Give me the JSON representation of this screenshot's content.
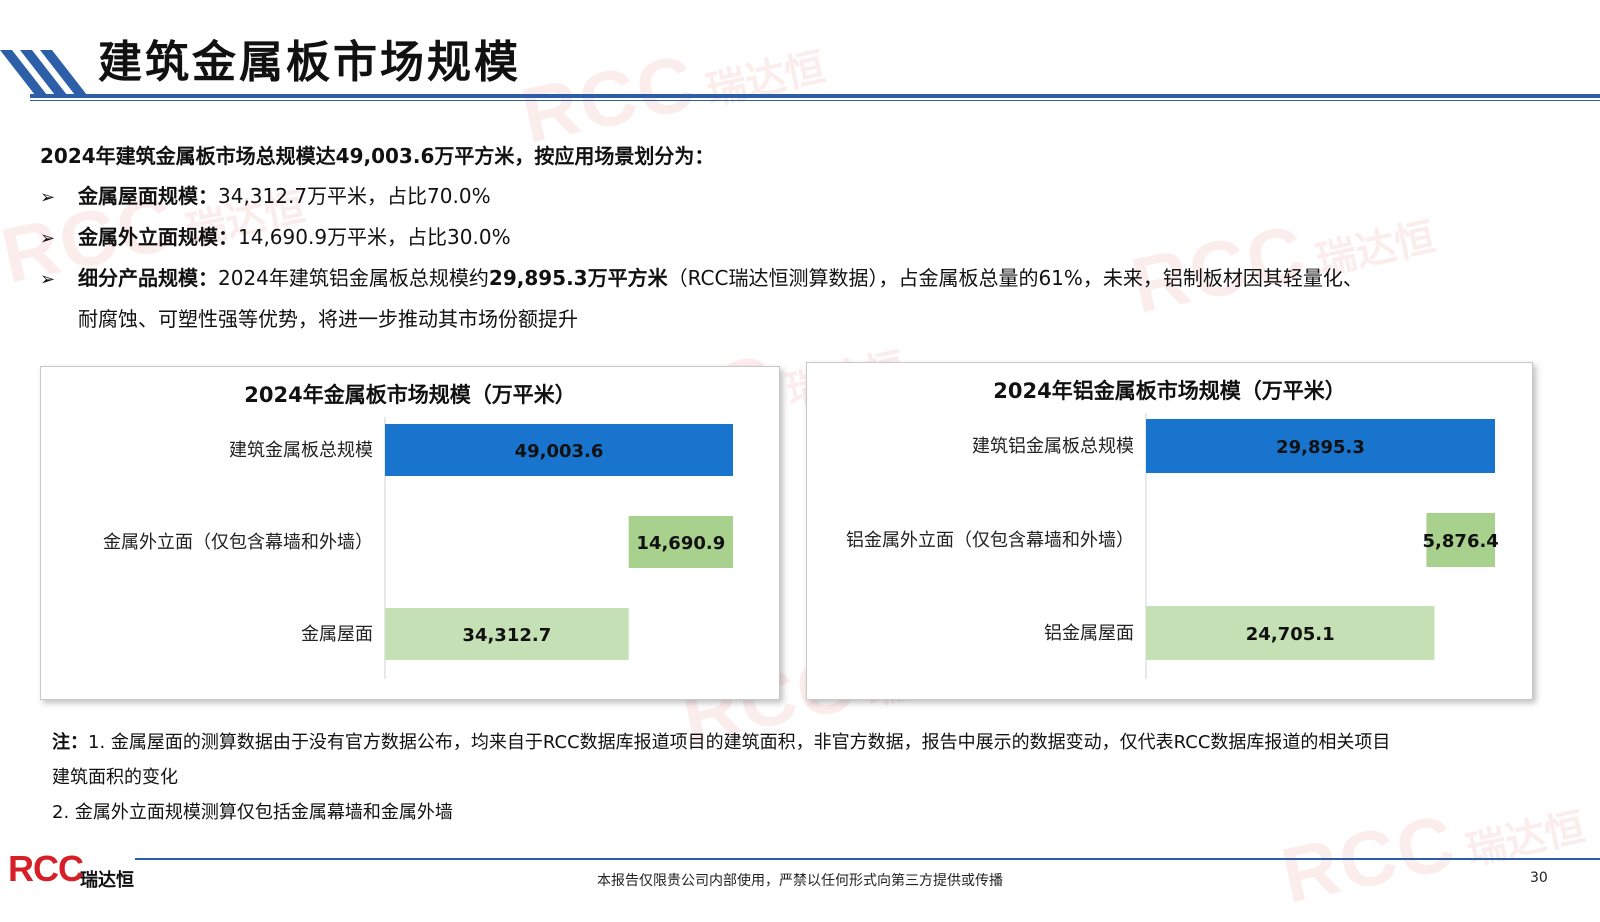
{
  "page": {
    "title": "建筑金属板市场规模",
    "number": "30",
    "footer": "本报告仅限贵公司内部使用，严禁以任何形式向第三方提供或传播",
    "logo_text": "RCC",
    "logo_cn": "瑞达恒",
    "watermark_text": "RCC",
    "watermark_cn": "瑞达恒"
  },
  "summary": {
    "intro": "2024年建筑金属板市场总规模达49,003.6万平方米，按应用场景划分为：",
    "bullets": [
      {
        "marker": "➢",
        "label": "金属屋面规模：",
        "text": "34,312.7万平米，占比70.0%"
      },
      {
        "marker": "➢",
        "label": "金属外立面规模：",
        "text": "14,690.9万平米，占比30.0%"
      },
      {
        "marker": "➢",
        "label": "细分产品规模：",
        "text_a": "2024年建筑铝金属板总规模约",
        "text_b": "29,895.3万平方米",
        "text_c": "（RCC瑞达恒测算数据），占金属板总量的61%，未来，铝制板材因其轻量化、",
        "text_d": "耐腐蚀、可塑性强等优势，将进一步推动其市场份额提升"
      }
    ]
  },
  "chart_data": [
    {
      "type": "bar",
      "orientation": "horizontal",
      "subtype": "waterfall",
      "title": "2024年金属板市场规模（万平米）",
      "categories": [
        "建筑金属板总规模",
        "金属外立面（仅包含幕墙和外墙）",
        "金属屋面"
      ],
      "values": [
        49003.6,
        14690.9,
        34312.7
      ],
      "value_labels": [
        "49,003.6",
        "14,690.9",
        "34,312.7"
      ],
      "offsets": [
        0,
        34312.7,
        0
      ],
      "colors": [
        "#1874cd",
        "#a9d18e",
        "#c5e0b4"
      ],
      "xlim": [
        0,
        49003.6
      ]
    },
    {
      "type": "bar",
      "orientation": "horizontal",
      "subtype": "waterfall",
      "title": "2024年铝金属板市场规模（万平米）",
      "categories": [
        "建筑铝金属板总规模",
        "铝金属外立面（仅包含幕墙和外墙）",
        "铝金属屋面"
      ],
      "values": [
        29895.3,
        5876.4,
        24705.1
      ],
      "value_labels": [
        "29,895.3",
        "5,876.4",
        "24,705.1"
      ],
      "offsets": [
        0,
        24018.9,
        0
      ],
      "colors": [
        "#1874cd",
        "#a9d18e",
        "#c5e0b4"
      ],
      "xlim": [
        0,
        29895.3
      ]
    }
  ],
  "notes": {
    "line1_label": "注：",
    "line1_text": "1. 金属屋面的测算数据由于没有官方数据公布，均来自于RCC数据库报道项目的建筑面积，非官方数据，报告中展示的数据变动，仅代表RCC数据库报道的相关项目",
    "line2_text": "建筑面积的变化",
    "line3_text": "2. 金属外立面规模测算仅包括金属幕墙和金属外墙"
  }
}
